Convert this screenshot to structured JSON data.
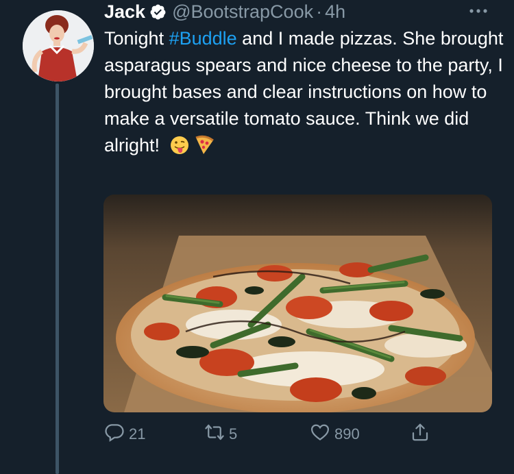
{
  "user": {
    "display_name": "Jack",
    "handle": "@BootstrapCook",
    "separator": "·",
    "time": "4h"
  },
  "tweet": {
    "text_before": "Tonight ",
    "hashtag": "#Buddle",
    "text_after": " and I made pizzas. She brought asparagus spears and nice cheese to the party, I brought bases and clear instructions on how to make a versatile tomato sauce. Think we did alright!",
    "emojis": [
      "tongue-out-emoji",
      "pizza-emoji"
    ]
  },
  "actions": {
    "reply_count": "21",
    "retweet_count": "5",
    "like_count": "890"
  },
  "icons": {
    "verified": "verified-badge-icon",
    "more": "more-dots-icon",
    "reply": "reply-icon",
    "retweet": "retweet-icon",
    "like": "heart-icon",
    "share": "share-icon"
  },
  "colors": {
    "background": "#15202b",
    "hashtag": "#1da1f2",
    "muted": "#8899a6",
    "verified": "#ffffff"
  }
}
